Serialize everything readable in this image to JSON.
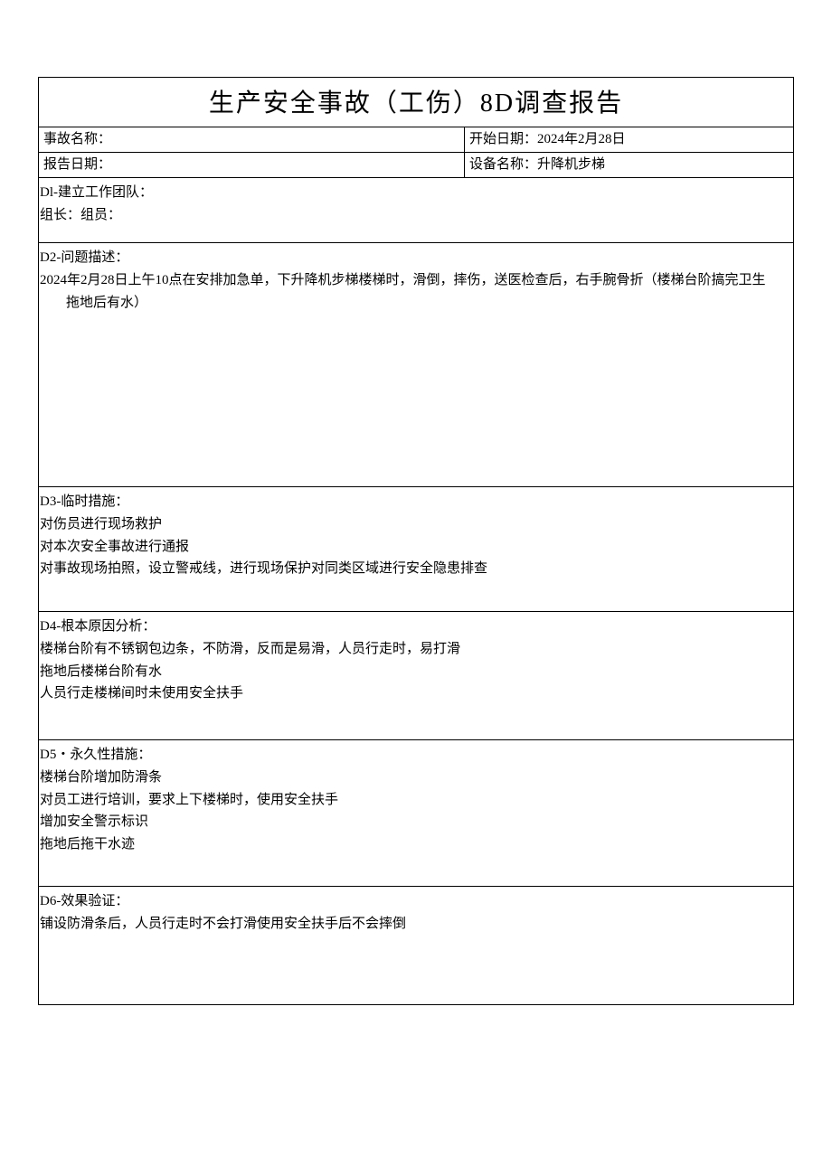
{
  "title": "生产安全事故（工伤）8D调查报告",
  "header": {
    "incident_name_label": "事故名称：",
    "start_date_label": "开始日期：",
    "start_date_value": "2024年2月28日",
    "report_date_label": "报告日期：",
    "equipment_label": "设备名称：",
    "equipment_value": "升降机步梯"
  },
  "d1": {
    "label": "Dl-建立工作团队：",
    "line1": "组长：组员："
  },
  "d2": {
    "label": "D2-问题描述：",
    "line1": "2024年2月28日上午10点在安排加急单，下升降机步梯楼梯时，滑倒，摔伤，送医检查后，右手腕骨折（楼梯台阶搞完卫生",
    "line2": "拖地后有水）"
  },
  "d3": {
    "label": "D3-临时措施：",
    "line1": "对伤员进行现场救护",
    "line2": "对本次安全事故进行通报",
    "line3": "对事故现场拍照，设立警戒线，进行现场保护对同类区域进行安全隐患排查"
  },
  "d4": {
    "label": "D4-根本原因分析：",
    "line1": "楼梯台阶有不锈钢包边条，不防滑，反而是易滑，人员行走时，易打滑",
    "line2": "拖地后楼梯台阶有水",
    "line3": "人员行走楼梯间时未使用安全扶手"
  },
  "d5": {
    "label": "D5・永久性措施：",
    "line1": "楼梯台阶增加防滑条",
    "line2": "对员工进行培训，要求上下楼梯时，使用安全扶手",
    "line3": "增加安全警示标识",
    "line4": "拖地后拖干水迹"
  },
  "d6": {
    "label": "D6-效果验证：",
    "line1": "铺设防滑条后，人员行走时不会打滑使用安全扶手后不会摔倒"
  }
}
